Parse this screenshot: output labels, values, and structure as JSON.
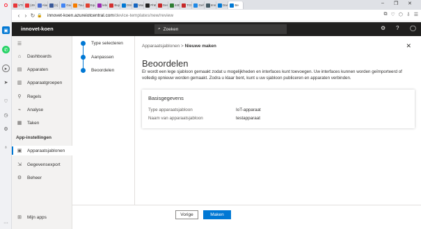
{
  "browser": {
    "tabs": [
      {
        "label": "VTI",
        "color": "#e8373a"
      },
      {
        "label": "(49",
        "color": "#e8373a"
      },
      {
        "label": "Alun",
        "color": "#4b6fd0"
      },
      {
        "label": "(1) F",
        "color": "#3b5998"
      },
      {
        "label": "Goo",
        "color": "#4285f4"
      },
      {
        "label": "Toun",
        "color": "#f57c00"
      },
      {
        "label": "Equ",
        "color": "#e04030"
      },
      {
        "label": "lebu",
        "color": "#9c27b0"
      },
      {
        "label": "Buy",
        "color": "#d32f2f"
      },
      {
        "label": "OSC",
        "color": "#0078d4"
      },
      {
        "label": "Mon",
        "color": "#1565c0"
      },
      {
        "label": "PhE",
        "color": "#222222"
      },
      {
        "label": "Gen",
        "color": "#c62828"
      },
      {
        "label": "44D",
        "color": "#2e7d32"
      },
      {
        "label": "TCN",
        "color": "#c62828"
      },
      {
        "label": "Geh",
        "color": "#1e88e5"
      },
      {
        "label": "Imn",
        "color": "#455a64"
      },
      {
        "label": "Dasl",
        "color": "#0078d4"
      },
      {
        "label": "Be",
        "color": "#0078d4"
      }
    ],
    "url_host": "innovet-koen.azureiotcentral.com",
    "url_path": "/device-templates/new/review"
  },
  "header": {
    "app_name": "innovet-koen",
    "search_placeholder": "Zoeken"
  },
  "nav": {
    "items": [
      {
        "label": "Dashboards",
        "icon": "dashboard-icon"
      },
      {
        "label": "Apparaten",
        "icon": "devices-icon"
      },
      {
        "label": "Apparaatgroepen",
        "icon": "device-groups-icon"
      },
      {
        "label": "Regels",
        "icon": "rules-icon"
      },
      {
        "label": "Analyse",
        "icon": "analytics-icon"
      },
      {
        "label": "Taken",
        "icon": "jobs-icon"
      }
    ],
    "section_title": "App-instellingen",
    "settings_items": [
      {
        "label": "Apparaatsjablonen",
        "icon": "templates-icon"
      },
      {
        "label": "Gegevensexport",
        "icon": "export-icon"
      },
      {
        "label": "Beheer",
        "icon": "admin-icon"
      }
    ],
    "my_apps": "Mijn apps"
  },
  "wizard": {
    "steps": [
      "Type selecteren",
      "Aanpassen",
      "Beoordelen"
    ],
    "active_step": 2
  },
  "main": {
    "breadcrumb_parent": "Apparaatsjablonen",
    "breadcrumb_sep": ">",
    "breadcrumb_current": "Nieuwe maken",
    "title": "Beoordelen",
    "description": "Er wordt een lege sjabloon gemaakt zodat u mogelijkheden en interfaces kunt toevoegen. Uw interfaces kunnen worden geïmporteerd of volledig opnieuw worden gemaakt. Zodra u klaar bent, kunt u uw sjabloon publiceren en apparaten verbinden.",
    "card": {
      "title": "Basisgegevens",
      "rows": [
        {
          "label": "Type apparaatsjabloon",
          "value": "IoT-apparaat"
        },
        {
          "label": "Naam van apparaatsjabloon",
          "value": "testapparaat"
        }
      ]
    }
  },
  "footer": {
    "prev_label": "Vorige",
    "make_label": "Maken"
  },
  "colors": {
    "accent": "#0078d4",
    "header_bg": "#201f1e",
    "nav_bg": "#f3f2f1"
  }
}
